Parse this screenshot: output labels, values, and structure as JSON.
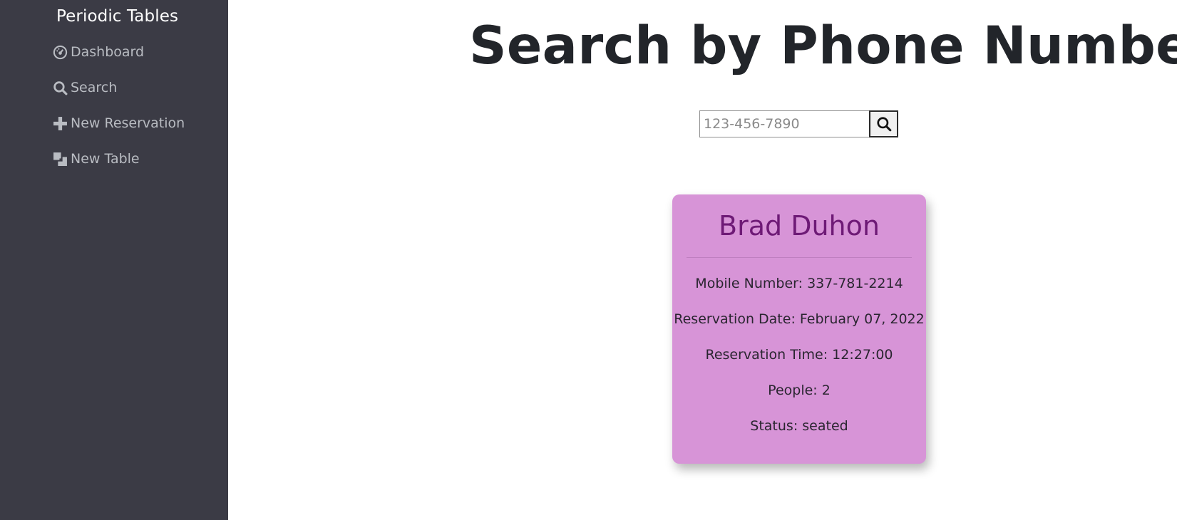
{
  "sidebar": {
    "brand": "Periodic Tables",
    "items": [
      {
        "label": "Dashboard",
        "icon": "dashboard-icon"
      },
      {
        "label": "Search",
        "icon": "search-icon"
      },
      {
        "label": "New Reservation",
        "icon": "plus-icon"
      },
      {
        "label": "New Table",
        "icon": "table-icon"
      }
    ],
    "background": "#3b3b45"
  },
  "main": {
    "title": "Search by Phone Number",
    "search": {
      "placeholder": "123-456-7890",
      "value": "",
      "button_icon": "search-icon"
    }
  },
  "card": {
    "name": "Brad Duhon",
    "mobile_number": "Mobile Number: 337-781-2214",
    "reservation_date": "Reservation Date: February 07, 2022",
    "reservation_time": "Reservation Time: 12:27:00",
    "people": "People: 2",
    "status": "Status: seated",
    "background": "#d794d7",
    "name_color": "#6e1a76"
  }
}
